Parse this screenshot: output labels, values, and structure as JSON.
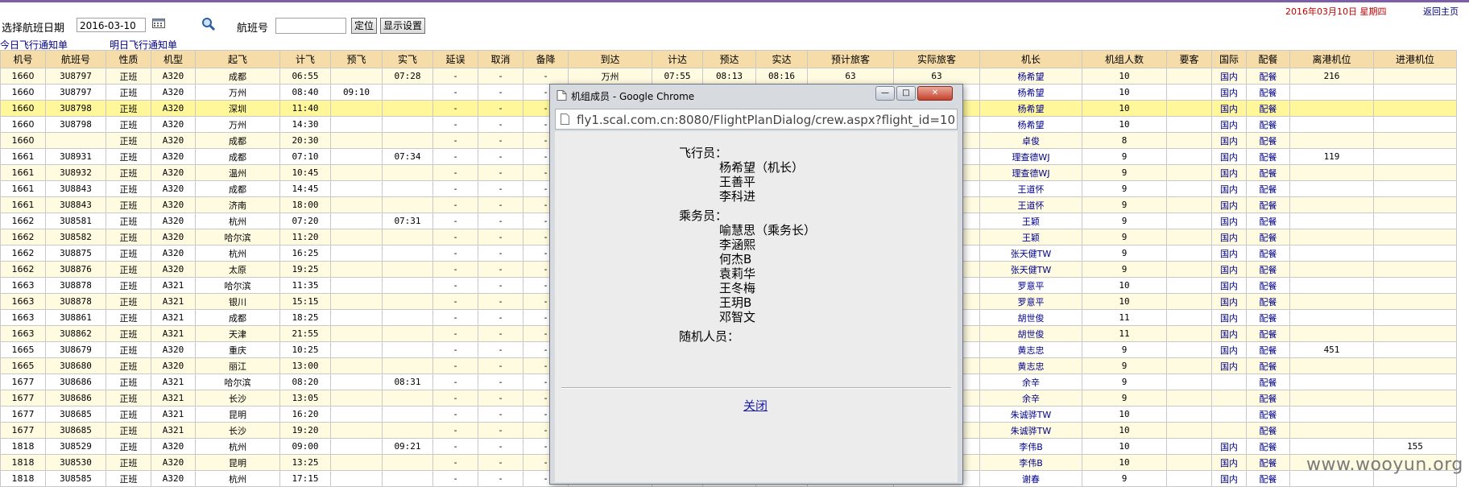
{
  "toolbar": {
    "date_label": "选择航班日期",
    "date_value": "2016-03-10",
    "flight_label": "航班号",
    "flight_value": "",
    "locate_button": "定位",
    "settings_button": "显示设置",
    "today_notice": "今日飞行通知单",
    "tomorrow_notice": "明日飞行通知单",
    "current_date": "2016年03月10日 星期四",
    "home_link": "返回主页"
  },
  "table": {
    "headers": [
      "机号",
      "航班号",
      "性质",
      "机型",
      "起飞",
      "计飞",
      "预飞",
      "实飞",
      "延误",
      "取消",
      "备降",
      "到达",
      "计达",
      "预达",
      "实达",
      "预计旅客",
      "实际旅客",
      "机长",
      "机组人数",
      "要客",
      "国际",
      "配餐",
      "离港机位",
      "进港机位"
    ],
    "rows": [
      [
        "1660",
        "3U8797",
        "正班",
        "A320",
        "成都",
        "06:55",
        "",
        "07:28",
        "-",
        "-",
        "-",
        "万州",
        "07:55",
        "08:13",
        "08:16",
        "63",
        "63",
        "杨希望",
        "10",
        "",
        "国内",
        "配餐",
        "216",
        ""
      ],
      [
        "1660",
        "3U8797",
        "正班",
        "A320",
        "万州",
        "08:40",
        "09:10",
        "",
        "-",
        "-",
        "-",
        "",
        "",
        "",
        "",
        "",
        "",
        "杨希望",
        "10",
        "",
        "国内",
        "配餐",
        "",
        ""
      ],
      [
        "1660",
        "3U8798",
        "正班",
        "A320",
        "深圳",
        "11:40",
        "",
        "",
        "-",
        "-",
        "-",
        "",
        "",
        "",
        "",
        "",
        "",
        "杨希望",
        "10",
        "",
        "国内",
        "配餐",
        "",
        ""
      ],
      [
        "1660",
        "3U8798",
        "正班",
        "A320",
        "万州",
        "14:30",
        "",
        "",
        "-",
        "-",
        "-",
        "",
        "",
        "",
        "",
        "",
        "",
        "杨希望",
        "10",
        "",
        "国内",
        "配餐",
        "",
        ""
      ],
      [
        "1660",
        "",
        "正班",
        "A320",
        "成都",
        "20:30",
        "",
        "",
        "-",
        "-",
        "-",
        "",
        "",
        "",
        "",
        "",
        "",
        "卓俊",
        "8",
        "",
        "国内",
        "配餐",
        "",
        ""
      ],
      [
        "1661",
        "3U8931",
        "正班",
        "A320",
        "成都",
        "07:10",
        "",
        "07:34",
        "-",
        "-",
        "-",
        "",
        "",
        "",
        "",
        "",
        "",
        "理查德WJ",
        "9",
        "",
        "国内",
        "配餐",
        "119",
        ""
      ],
      [
        "1661",
        "3U8932",
        "正班",
        "A320",
        "温州",
        "10:45",
        "",
        "",
        "-",
        "-",
        "-",
        "",
        "",
        "",
        "",
        "",
        "",
        "理查德WJ",
        "9",
        "",
        "国内",
        "配餐",
        "",
        ""
      ],
      [
        "1661",
        "3U8843",
        "正班",
        "A320",
        "成都",
        "14:45",
        "",
        "",
        "-",
        "-",
        "-",
        "",
        "",
        "",
        "",
        "",
        "",
        "王道怀",
        "9",
        "",
        "国内",
        "配餐",
        "",
        ""
      ],
      [
        "1661",
        "3U8843",
        "正班",
        "A320",
        "济南",
        "18:00",
        "",
        "",
        "-",
        "-",
        "-",
        "",
        "",
        "",
        "",
        "",
        "",
        "王道怀",
        "9",
        "",
        "国内",
        "配餐",
        "",
        ""
      ],
      [
        "1662",
        "3U8581",
        "正班",
        "A320",
        "杭州",
        "07:20",
        "",
        "07:31",
        "-",
        "-",
        "-",
        "",
        "",
        "",
        "",
        "",
        "",
        "王颖",
        "9",
        "",
        "国内",
        "配餐",
        "",
        ""
      ],
      [
        "1662",
        "3U8582",
        "正班",
        "A320",
        "哈尔滨",
        "11:20",
        "",
        "",
        "-",
        "-",
        "-",
        "",
        "",
        "",
        "",
        "",
        "",
        "王颖",
        "9",
        "",
        "国内",
        "配餐",
        "",
        ""
      ],
      [
        "1662",
        "3U8875",
        "正班",
        "A320",
        "杭州",
        "16:25",
        "",
        "",
        "-",
        "-",
        "-",
        "",
        "",
        "",
        "",
        "",
        "",
        "张天健TW",
        "9",
        "",
        "国内",
        "配餐",
        "",
        ""
      ],
      [
        "1662",
        "3U8876",
        "正班",
        "A320",
        "太原",
        "19:25",
        "",
        "",
        "-",
        "-",
        "-",
        "",
        "",
        "",
        "",
        "",
        "",
        "张天健TW",
        "9",
        "",
        "国内",
        "配餐",
        "",
        ""
      ],
      [
        "1663",
        "3U8878",
        "正班",
        "A321",
        "哈尔滨",
        "11:35",
        "",
        "",
        "-",
        "-",
        "-",
        "",
        "",
        "",
        "",
        "",
        "",
        "罗意平",
        "10",
        "",
        "国内",
        "配餐",
        "",
        ""
      ],
      [
        "1663",
        "3U8878",
        "正班",
        "A321",
        "银川",
        "15:15",
        "",
        "",
        "-",
        "-",
        "-",
        "",
        "",
        "",
        "",
        "",
        "",
        "罗意平",
        "10",
        "",
        "国内",
        "配餐",
        "",
        ""
      ],
      [
        "1663",
        "3U8861",
        "正班",
        "A321",
        "成都",
        "18:25",
        "",
        "",
        "-",
        "-",
        "-",
        "",
        "",
        "",
        "",
        "",
        "",
        "胡世俊",
        "11",
        "",
        "国内",
        "配餐",
        "",
        ""
      ],
      [
        "1663",
        "3U8862",
        "正班",
        "A321",
        "天津",
        "21:55",
        "",
        "",
        "-",
        "-",
        "-",
        "",
        "",
        "",
        "",
        "",
        "",
        "胡世俊",
        "11",
        "",
        "国内",
        "配餐",
        "",
        ""
      ],
      [
        "1665",
        "3U8679",
        "正班",
        "A320",
        "重庆",
        "10:25",
        "",
        "",
        "-",
        "-",
        "-",
        "",
        "",
        "",
        "",
        "",
        "",
        "黄志忠",
        "9",
        "",
        "国内",
        "配餐",
        "451",
        ""
      ],
      [
        "1665",
        "3U8680",
        "正班",
        "A320",
        "丽江",
        "13:00",
        "",
        "",
        "-",
        "-",
        "-",
        "",
        "",
        "",
        "",
        "",
        "",
        "黄志忠",
        "9",
        "",
        "国内",
        "配餐",
        "",
        ""
      ],
      [
        "1677",
        "3U8686",
        "正班",
        "A321",
        "哈尔滨",
        "08:20",
        "",
        "08:31",
        "-",
        "-",
        "-",
        "",
        "",
        "",
        "",
        "",
        "",
        "余辛",
        "9",
        "",
        "",
        "配餐",
        "",
        ""
      ],
      [
        "1677",
        "3U8686",
        "正班",
        "A321",
        "长沙",
        "13:05",
        "",
        "",
        "-",
        "-",
        "-",
        "",
        "",
        "",
        "",
        "",
        "",
        "余辛",
        "9",
        "",
        "",
        "配餐",
        "",
        ""
      ],
      [
        "1677",
        "3U8685",
        "正班",
        "A321",
        "昆明",
        "16:20",
        "",
        "",
        "-",
        "-",
        "-",
        "",
        "",
        "",
        "",
        "",
        "",
        "朱诚骅TW",
        "10",
        "",
        "",
        "配餐",
        "",
        ""
      ],
      [
        "1677",
        "3U8685",
        "正班",
        "A321",
        "长沙",
        "19:20",
        "",
        "",
        "-",
        "-",
        "-",
        "",
        "",
        "",
        "",
        "",
        "",
        "朱诚骅TW",
        "10",
        "",
        "",
        "配餐",
        "",
        ""
      ],
      [
        "1818",
        "3U8529",
        "正班",
        "A320",
        "杭州",
        "09:00",
        "",
        "09:21",
        "-",
        "-",
        "-",
        "",
        "",
        "",
        "",
        "",
        "",
        "李伟B",
        "10",
        "",
        "国内",
        "配餐",
        "",
        "155"
      ],
      [
        "1818",
        "3U8530",
        "正班",
        "A320",
        "昆明",
        "13:25",
        "",
        "",
        "-",
        "-",
        "-",
        "",
        "",
        "",
        "",
        "",
        "",
        "李伟B",
        "10",
        "",
        "国内",
        "配餐",
        "",
        ""
      ],
      [
        "1818",
        "3U8585",
        "正班",
        "A320",
        "杭州",
        "17:15",
        "",
        "",
        "-",
        "-",
        "-",
        "",
        "",
        "",
        "",
        "",
        "",
        "谢春",
        "9",
        "",
        "国内",
        "配餐",
        "",
        ""
      ]
    ],
    "row_classes": [
      "even",
      "odd",
      "hl",
      "odd",
      "even",
      "odd",
      "even",
      "odd",
      "even",
      "odd",
      "even",
      "odd",
      "even",
      "odd",
      "even",
      "odd",
      "even",
      "odd",
      "even",
      "odd",
      "even",
      "odd",
      "even",
      "odd",
      "even",
      "odd"
    ]
  },
  "dialog": {
    "title": "机组成员 - Google Chrome",
    "url": "fly1.scal.com.cn:8080/FlightPlanDialog/crew.aspx?flight_id=10",
    "pilots_label": "飞行员：",
    "pilots": [
      "杨希望（机长）",
      "王善平",
      "李科进"
    ],
    "cabin_label": "乘务员：",
    "cabin": [
      "喻慧思（乘务长）",
      "李涵熙",
      "何杰B",
      "袁莉华",
      "王冬梅",
      "王玥B",
      "邓智文"
    ],
    "extra_label": "随机人员：",
    "close_link": "关闭"
  },
  "watermark": "www.wooyun.org"
}
